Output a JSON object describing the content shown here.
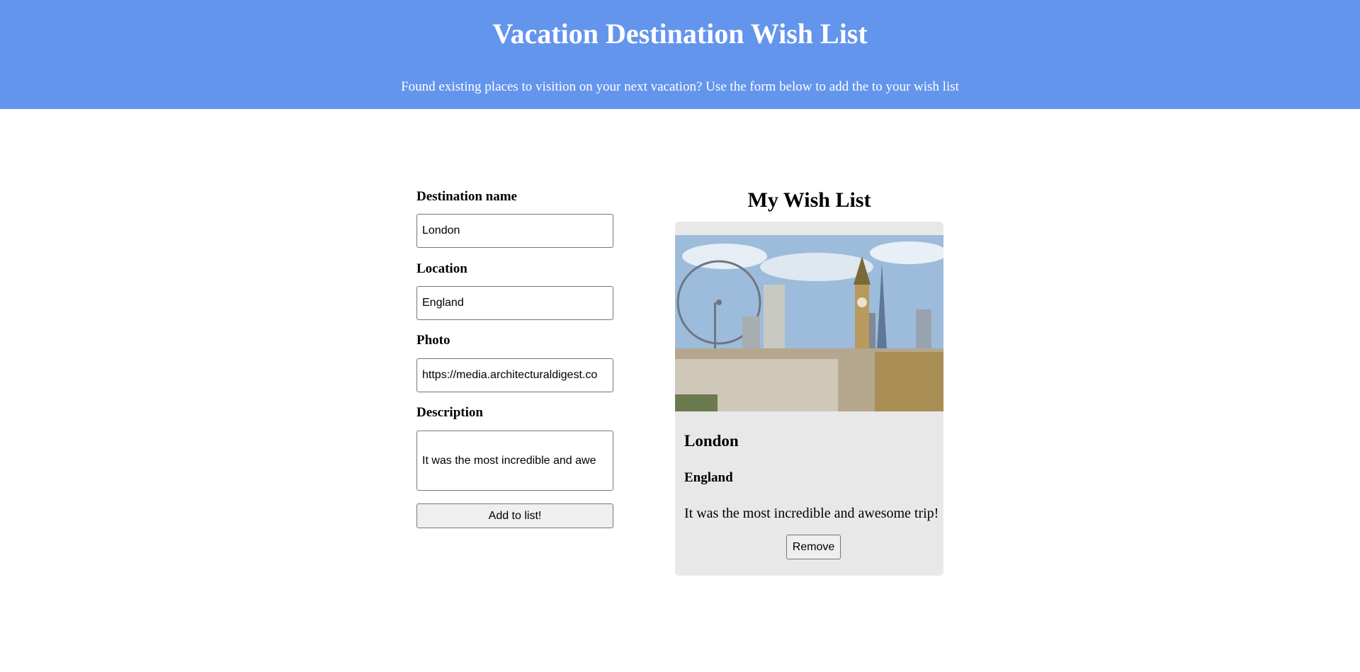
{
  "header": {
    "title": "Vacation Destination Wish List",
    "subtitle": "Found existing places to visition on your next vacation? Use the form below to add the to your wish list"
  },
  "form": {
    "destination_label": "Destination name",
    "destination_value": "London",
    "location_label": "Location",
    "location_value": "England",
    "photo_label": "Photo",
    "photo_value": "https://media.architecturaldigest.co",
    "description_label": "Description",
    "description_value": "It was the most incredible and awe",
    "add_button": "Add to list!"
  },
  "wishlist": {
    "title": "My Wish List",
    "cards": [
      {
        "name": "London",
        "location": "England",
        "description": "It was the most incredible and awesome trip!",
        "remove_button": "Remove"
      }
    ]
  },
  "colors": {
    "header_bg": "#6495ed",
    "card_bg": "#e8e8e8"
  }
}
